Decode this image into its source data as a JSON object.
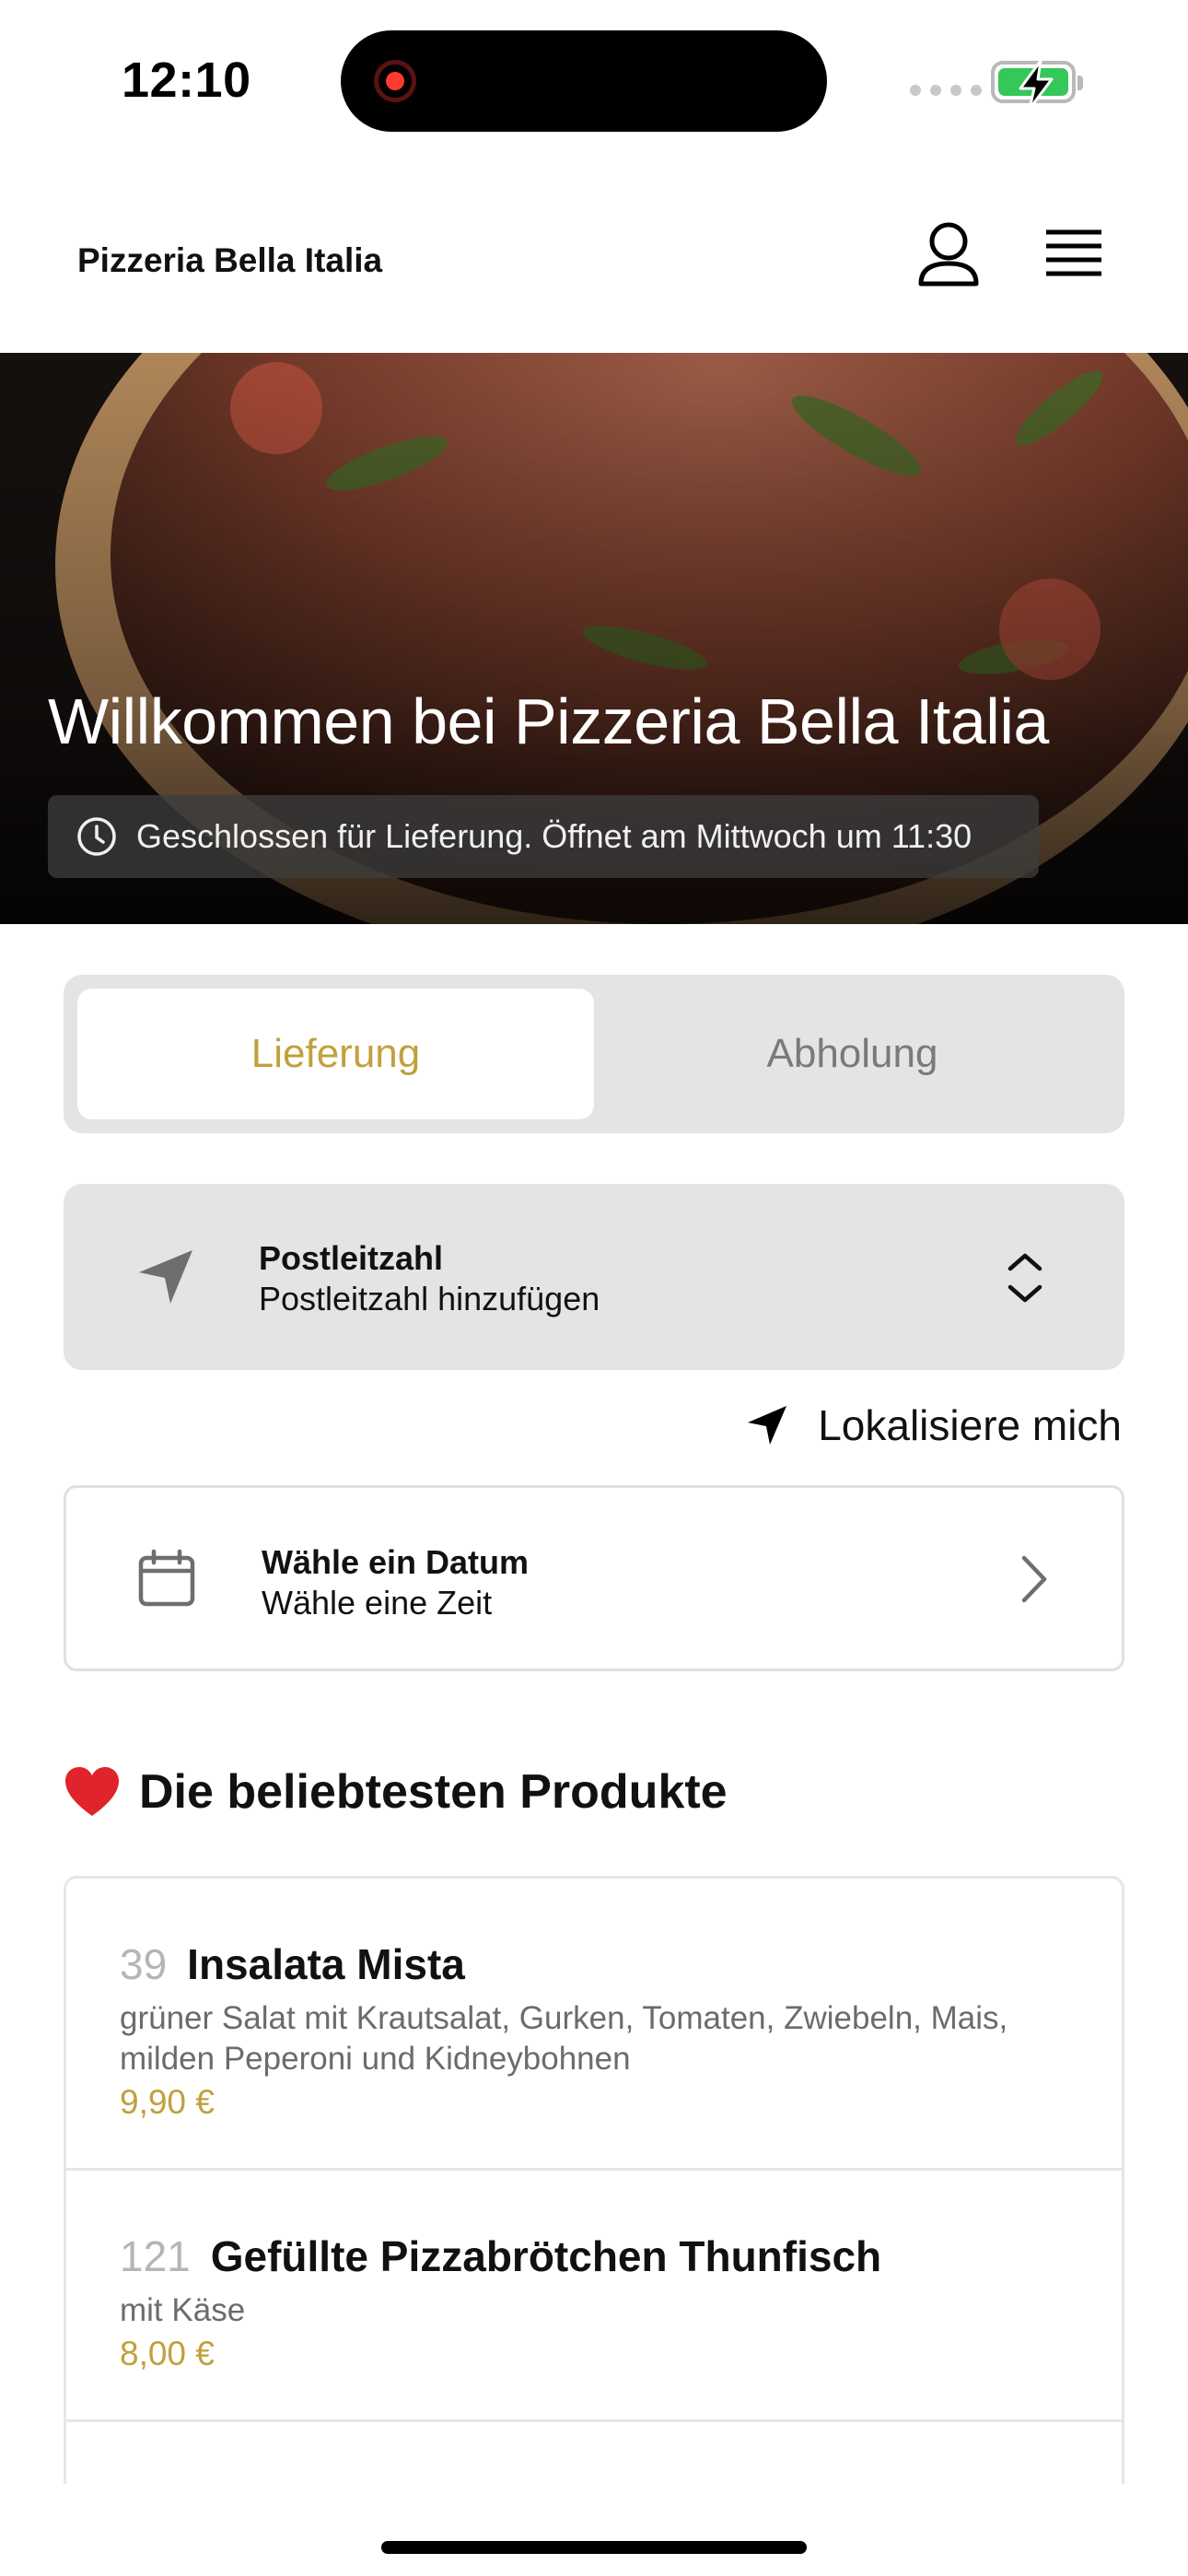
{
  "status_bar": {
    "time": "12:10",
    "icons": [
      "screen-recording-icon",
      "cellular-signal-icon",
      "battery-charging-icon"
    ],
    "battery_color": "#34c759"
  },
  "header": {
    "brand": "Pizzeria Bella Italia",
    "icons": [
      "user-icon",
      "hamburger-menu-icon"
    ]
  },
  "hero": {
    "title": "Willkommen bei Pizzeria Bella Italia",
    "status": "Geschlossen für Lieferung. Öffnet am Mittwoch um 11:30",
    "status_icon": "clock-icon"
  },
  "tabs": [
    {
      "label": "Lieferung",
      "active": true
    },
    {
      "label": "Abholung",
      "active": false
    }
  ],
  "postcode": {
    "title": "Postleitzahl",
    "placeholder": "Postleitzahl hinzufügen",
    "icon": "location-arrow-icon"
  },
  "localize": {
    "label": "Lokalisiere mich",
    "icon": "navigation-arrow-icon"
  },
  "date_picker": {
    "title": "Wähle ein Datum",
    "subtitle": "Wähle eine Zeit",
    "icon": "calendar-icon"
  },
  "popular": {
    "heading": "Die beliebtesten Produkte",
    "icon": "heart-icon",
    "products": [
      {
        "number": "39",
        "name": "Insalata Mista",
        "description": "grüner Salat mit Krautsalat, Gurken, Tomaten, Zwiebeln, Mais, milden Peperoni und Kidneybohnen",
        "price": "9,90 €"
      },
      {
        "number": "121",
        "name": "Gefüllte Pizzabrötchen Thunfisch",
        "description": "mit Käse",
        "price": "8,00 €"
      }
    ]
  },
  "colors": {
    "accent": "#c0a13c",
    "panel": "#e4e4e4",
    "border": "#e0e0e0"
  }
}
